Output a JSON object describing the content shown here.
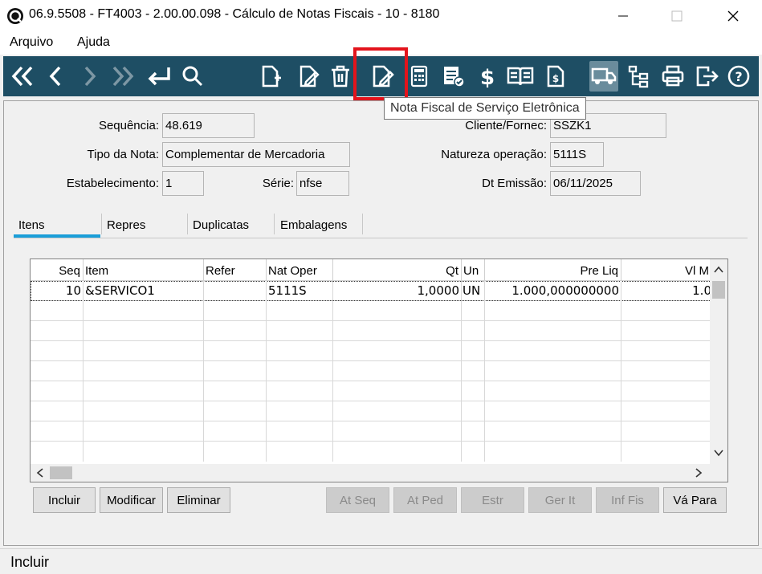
{
  "window": {
    "title": "06.9.5508 - FT4003 - 2.00.00.098 - Cálculo de Notas Fiscais - 10 - 8180"
  },
  "menu": [
    "Arquivo",
    "Ajuda"
  ],
  "toolbar": {
    "icons": [
      "first-icon",
      "prev-icon",
      "next-icon",
      "last-icon",
      "return-icon",
      "search-icon",
      "new-doc-icon",
      "edit-doc-icon",
      "trash-icon",
      "nfse-icon",
      "calculator-icon",
      "list-check-icon",
      "dollar-icon",
      "book-icon",
      "receipt-icon",
      "truck-icon",
      "tree-icon",
      "print-icon",
      "exit-icon",
      "help-icon"
    ],
    "tooltip": "Nota Fiscal de Serviço Eletrônica"
  },
  "form": {
    "sequencia_label": "Sequência:",
    "sequencia_value": "48.619",
    "tipo_label": "Tipo da Nota:",
    "tipo_value": "Complementar de Mercadoria",
    "estab_label": "Estabelecimento:",
    "estab_value": "1",
    "serie_label": "Série:",
    "serie_value": "nfse",
    "cliente_label": "Cliente/Fornec:",
    "cliente_value": "SSZK1",
    "natureza_label": "Natureza operação:",
    "natureza_value": "5111S",
    "dt_label": "Dt Emissão:",
    "dt_value": "06/11/2025"
  },
  "tabs": [
    "Itens",
    "Repres",
    "Duplicatas",
    "Embalagens"
  ],
  "grid": {
    "headers": [
      "Seq",
      "Item",
      "Refer",
      "Nat Oper",
      "Qt",
      "Un",
      "Pre Liq",
      "Vl M"
    ],
    "rows": [
      [
        "10",
        "&SERVICO1",
        "",
        "5111S",
        "1,0000",
        "UN",
        "1.000,000000000",
        "1.0"
      ]
    ]
  },
  "buttons": {
    "incluir": "Incluir",
    "modificar": "Modificar",
    "eliminar": "Eliminar",
    "at_seq": "At Seq",
    "at_ped": "At Ped",
    "estr": "Estr",
    "ger_it": "Ger It",
    "inf_fis": "Inf Fis",
    "va_para": "Vá Para"
  },
  "status": "Incluir",
  "colors": {
    "toolbar_bg": "#1e4e64",
    "highlight": "#e3141c",
    "tab_accent": "#1a9ed8"
  }
}
